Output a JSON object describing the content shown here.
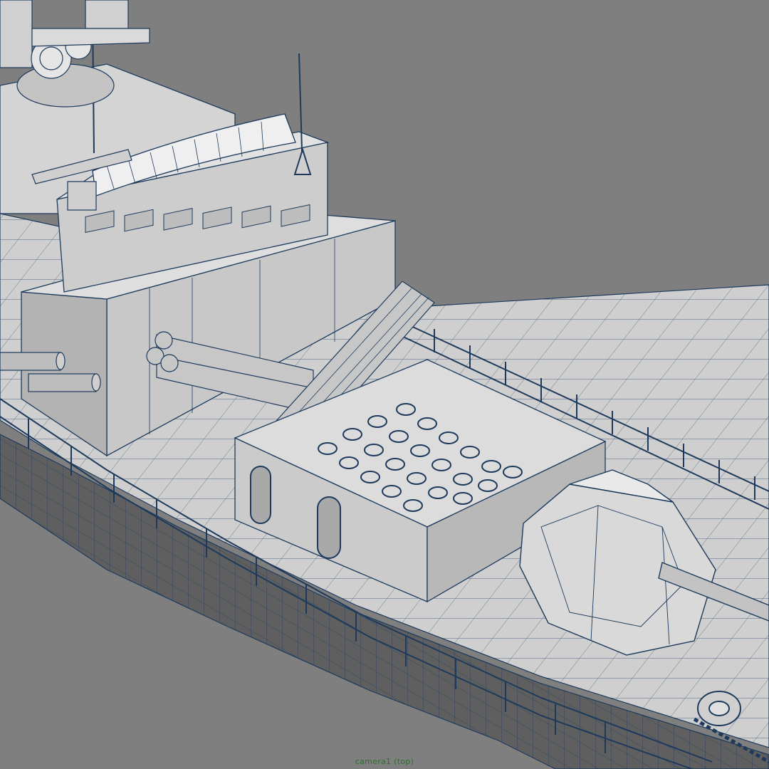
{
  "viewport": {
    "camera_label": "camera1 (top)",
    "colors": {
      "background": "#7f7f7f",
      "surface": "#d8d8d8",
      "surface_shade": "#b9b9b9",
      "surface_dark": "#a3a3a3",
      "wireframe": "#1d3a5c"
    }
  }
}
